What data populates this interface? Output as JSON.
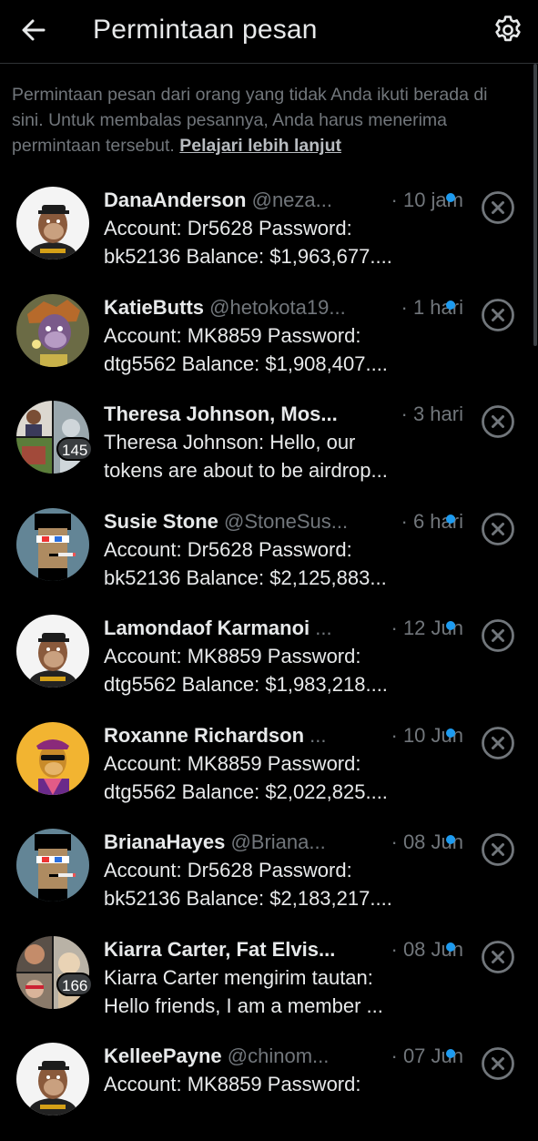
{
  "header": {
    "title": "Permintaan pesan",
    "back_icon": "arrow-left-icon",
    "settings_icon": "gear-icon"
  },
  "info": {
    "text": "Permintaan pesan dari orang yang tidak Anda ikuti berada di sini. Untuk membalas pesannya, Anda harus menerima permintaan tersebut. ",
    "link": "Pelajari lebih lanjut"
  },
  "colors": {
    "background": "#000000",
    "text_primary": "#e7e9ea",
    "text_secondary": "#71767b",
    "unread_dot": "#1d9bf0"
  },
  "requests": [
    {
      "name": "DanaAnderson",
      "handle": "@neza...",
      "time": "· 10 jam",
      "line1": "Account: Dr5628 Password:",
      "line2": "bk52136  Balance: $1,963,677....",
      "unread": true,
      "avatar": "ape-white"
    },
    {
      "name": "KatieButts",
      "handle": "@hetokota19...",
      "time": "· 1 hari",
      "line1": "Account: MK8859 Password:",
      "line2": "dtg5562 Balance: $1,908,407....",
      "unread": true,
      "avatar": "ape-brown"
    },
    {
      "name": "Theresa Johnson, Mos...",
      "handle": "",
      "time": "· 3 hari",
      "line1": "Theresa Johnson: Hello, our",
      "line2": "tokens are about to be airdrop...",
      "unread": false,
      "avatar": "group",
      "badge": "145"
    },
    {
      "name": "Susie Stone",
      "handle": "@StoneSus...",
      "time": "· 6 hari",
      "line1": "Account: Dr5628 Password:",
      "line2": "bk52136  Balance: $2,125,883...",
      "unread": true,
      "avatar": "punk"
    },
    {
      "name": "Lamondaof Karmanoi",
      "handle": "...",
      "time": "· 12 Jun",
      "line1": "Account: MK8859 Password:",
      "line2": "dtg5562 Balance: $1,983,218....",
      "unread": true,
      "avatar": "ape-white"
    },
    {
      "name": "Roxanne Richardson",
      "handle": "...",
      "time": "· 10 Jun",
      "line1": "Account: MK8859 Password:",
      "line2": "dtg5562 Balance: $2,022,825....",
      "unread": true,
      "avatar": "ape-yellow"
    },
    {
      "name": "BrianaHayes",
      "handle": "@Briana...",
      "time": "· 08 Jun",
      "line1": "Account: Dr5628 Password:",
      "line2": "bk52136  Balance: $2,183,217....",
      "unread": true,
      "avatar": "punk"
    },
    {
      "name": "Kiarra Carter, Fat Elvis...",
      "handle": "",
      "time": "· 08 Jun",
      "line1": "Kiarra Carter mengirim tautan:",
      "line2": "Hello friends, I am a member ...",
      "unread": true,
      "avatar": "group2",
      "badge": "166"
    },
    {
      "name": "KelleePayne",
      "handle": "@chinom...",
      "time": "· 07 Jun",
      "line1": "Account: MK8859 Password:",
      "line2": "",
      "unread": true,
      "avatar": "ape-white"
    }
  ]
}
